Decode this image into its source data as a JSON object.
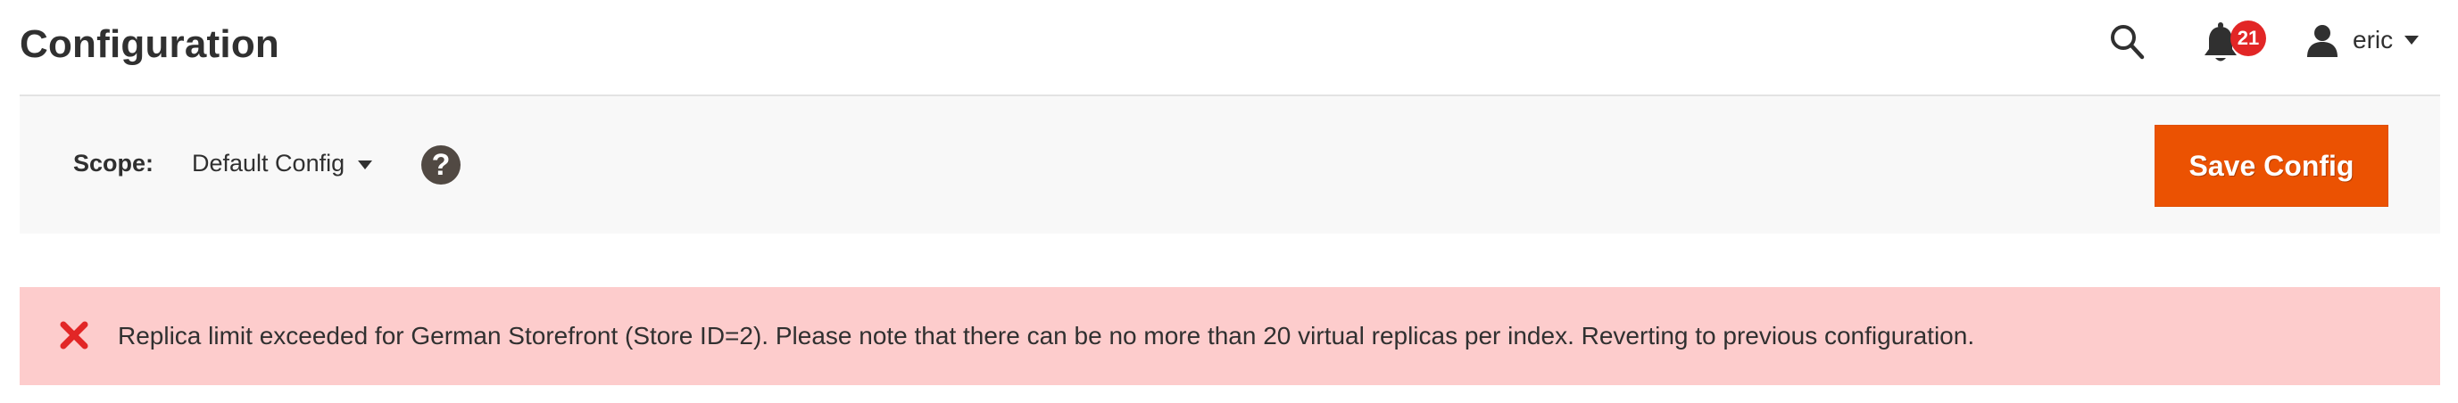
{
  "header": {
    "title": "Configuration",
    "notifications": {
      "count": "21"
    },
    "user": {
      "name": "eric"
    }
  },
  "icons": {
    "search": "search-icon",
    "notifications": "bell-icon",
    "user": "user-icon",
    "dropdown": "caret-down-icon",
    "help": "question-icon",
    "error": "close-x-icon"
  },
  "scope": {
    "label": "Scope:",
    "selected": "Default Config",
    "help_glyph": "?"
  },
  "actions": {
    "save_label": "Save Config"
  },
  "messages": [
    {
      "type": "error",
      "text": "Replica limit exceeded for German Storefront (Store ID=2). Please note that there can be no more than 20 virtual replicas per index. Reverting to previous configuration."
    }
  ],
  "colors": {
    "accent": "#eb5202",
    "error_bg": "#fdcccc",
    "error_icon": "#e22626",
    "badge": "#e22626",
    "scope_bar_bg": "#f8f8f8",
    "help_bg": "#514943"
  }
}
